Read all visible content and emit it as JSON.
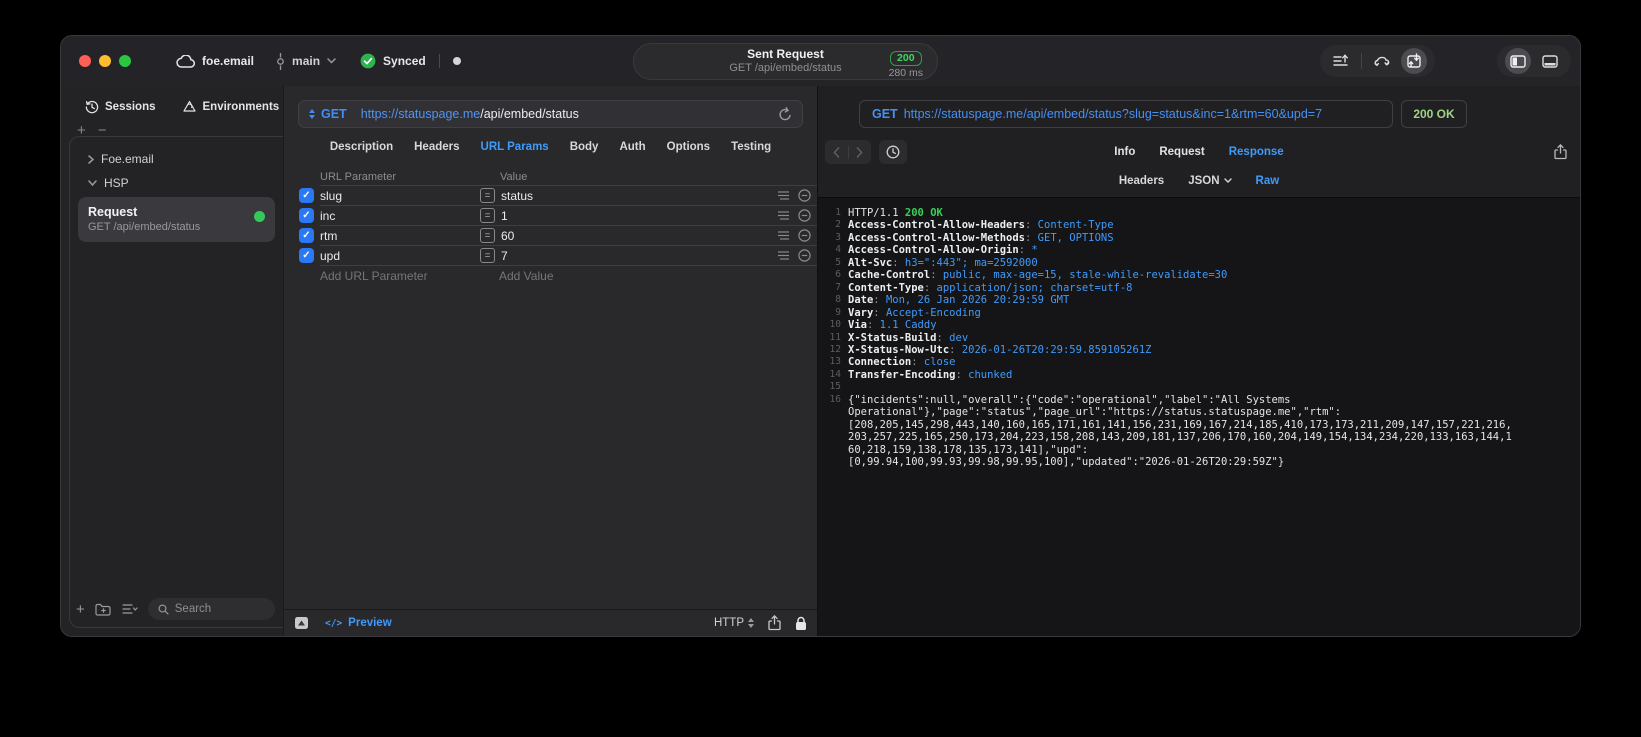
{
  "titlebar": {
    "project": "foe.email",
    "branch": "main",
    "sync_label": "Synced",
    "title": "Sent Request",
    "subtitle": "GET /api/embed/status",
    "status_code": "200",
    "duration": "280 ms"
  },
  "sidebar": {
    "tabs": [
      {
        "label": "Sessions",
        "icon": "history-icon"
      },
      {
        "label": "Environments",
        "icon": "layers-icon"
      }
    ],
    "tree": [
      {
        "label": "Foe.email",
        "expanded": false
      },
      {
        "label": "HSP",
        "expanded": true
      }
    ],
    "request": {
      "title": "Request",
      "subtitle": "GET /api/embed/status",
      "status_color": "#34c85a"
    },
    "search_placeholder": "Search"
  },
  "request_pane": {
    "method": "GET",
    "url_host": "https://statuspage.me",
    "url_path": "/api/embed/status",
    "tabs": [
      "Description",
      "Headers",
      "URL Params",
      "Body",
      "Auth",
      "Options",
      "Testing"
    ],
    "active_tab": "URL Params",
    "table": {
      "columns": [
        "URL Parameter",
        "Value"
      ],
      "rows": [
        {
          "name": "slug",
          "value": "status",
          "checked": true
        },
        {
          "name": "inc",
          "value": "1",
          "checked": true
        },
        {
          "name": "rtm",
          "value": "60",
          "checked": true
        },
        {
          "name": "upd",
          "value": "7",
          "checked": true
        }
      ],
      "add_row": {
        "name_placeholder": "Add URL Parameter",
        "value_placeholder": "Add Value"
      }
    },
    "footer": {
      "preview_label": "Preview",
      "code_glyph": "</>",
      "protocol_label": "HTTP"
    }
  },
  "response_pane": {
    "method": "GET",
    "url": "https://statuspage.me/api/embed/status?slug=status&inc=1&rtm=60&upd=7",
    "status": "200 OK",
    "tabs": [
      "Info",
      "Request",
      "Response"
    ],
    "active_tab": "Response",
    "subtabs": [
      "Headers",
      "JSON",
      "Raw"
    ],
    "active_subtab": "Raw",
    "body": {
      "status_line": {
        "protocol": "HTTP/1.1 ",
        "status": "200 OK"
      },
      "headers": [
        {
          "name": "Access-Control-Allow-Headers",
          "value": "Content-Type"
        },
        {
          "name": "Access-Control-Allow-Methods",
          "value": "GET, OPTIONS"
        },
        {
          "name": "Access-Control-Allow-Origin",
          "value": "*"
        },
        {
          "name": "Alt-Svc",
          "value": "h3=\":443\"; ma=2592000"
        },
        {
          "name": "Cache-Control",
          "value": "public, max-age=15, stale-while-revalidate=30"
        },
        {
          "name": "Content-Type",
          "value": "application/json; charset=utf-8"
        },
        {
          "name": "Date",
          "value": "Mon, 26 Jan 2026 20:29:59 GMT"
        },
        {
          "name": "Vary",
          "value": "Accept-Encoding"
        },
        {
          "name": "Via",
          "value": "1.1 Caddy"
        },
        {
          "name": "X-Status-Build",
          "value": "dev"
        },
        {
          "name": "X-Status-Now-Utc",
          "value": "2026-01-26T20:29:59.859105261Z"
        },
        {
          "name": "Connection",
          "value": "close"
        },
        {
          "name": "Transfer-Encoding",
          "value": "chunked"
        }
      ],
      "json_line_number": "16",
      "json_lines": [
        "{\"incidents\":null,\"overall\":{\"code\":\"operational\",\"label\":\"All Systems",
        "Operational\"},\"page\":\"status\",\"page_url\":\"https://status.statuspage.me\",\"rtm\":",
        "[208,205,145,298,443,140,160,165,171,161,141,156,231,169,167,214,185,410,173,173,211,209,147,157,221,216,",
        "203,257,225,165,250,173,204,223,158,208,143,209,181,137,206,170,160,204,149,154,134,234,220,133,163,144,1",
        "60,218,159,138,178,135,173,141],\"upd\":",
        "[0,99.94,100,99.93,99.98,99.95,100],\"updated\":\"2026-01-26T20:29:59Z\"}"
      ]
    }
  },
  "colors": {
    "accent_blue": "#3f9bfb",
    "status_green": "#35d158",
    "badge_green": "#3cd663"
  }
}
